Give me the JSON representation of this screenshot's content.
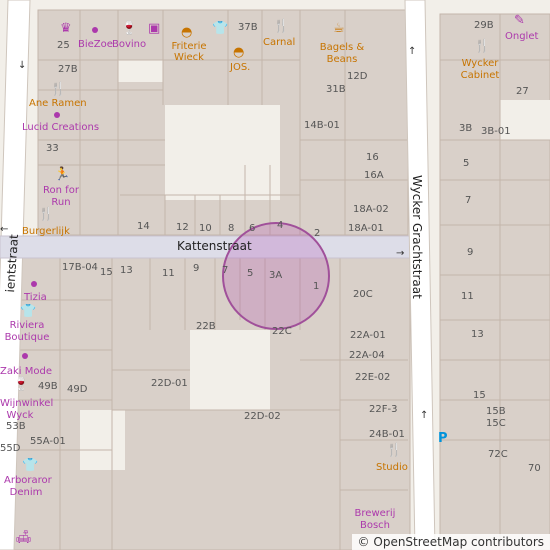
{
  "map": {
    "streets": [
      {
        "name": "Kattenstraat"
      },
      {
        "name": "Wycker Grachtstraat"
      },
      {
        "name": "ientstraat"
      }
    ],
    "building_numbers": [
      "25",
      "27B",
      "33",
      "37B",
      "31B",
      "12D",
      "14B-01",
      "16",
      "16A",
      "18A-02",
      "18A-01",
      "14",
      "12",
      "10",
      "8",
      "6",
      "4",
      "2",
      "17B-04",
      "15",
      "13",
      "11",
      "9",
      "7",
      "5",
      "3A",
      "1",
      "20C",
      "22B",
      "22C",
      "22A-01",
      "22A-04",
      "49B",
      "49D",
      "22D-01",
      "22E-02",
      "22D-02",
      "22F-3",
      "53B",
      "55A-01",
      "55D",
      "24B-01",
      "29B",
      "27",
      "3B",
      "3B-01",
      "5",
      "7",
      "9",
      "11",
      "13",
      "15",
      "15B",
      "15C",
      "72C",
      "70"
    ],
    "pois": [
      {
        "name": "BieZoe",
        "category": "shop"
      },
      {
        "name": "Bovino",
        "category": "shop"
      },
      {
        "name": "Friterie Wieck",
        "category": "fast-food"
      },
      {
        "name": "JOS.",
        "category": "fast-food"
      },
      {
        "name": "Carnal",
        "category": "restaurant"
      },
      {
        "name": "Bagels & Beans",
        "category": "cafe"
      },
      {
        "name": "Onglet",
        "category": "shop"
      },
      {
        "name": "Wycker Cabinet",
        "category": "restaurant"
      },
      {
        "name": "Ane Ramen",
        "category": "restaurant"
      },
      {
        "name": "Lucid Creations",
        "category": "shop"
      },
      {
        "name": "Ron for Run",
        "category": "sports"
      },
      {
        "name": "Burgerlijk",
        "category": "restaurant"
      },
      {
        "name": "Tizia",
        "category": "shop"
      },
      {
        "name": "Riviera Boutique",
        "category": "clothes"
      },
      {
        "name": "Zaki Mode",
        "category": "shop"
      },
      {
        "name": "Wijnwinkel Wyck",
        "category": "wine"
      },
      {
        "name": "Arboraror Denim",
        "category": "clothes"
      },
      {
        "name": "Studio",
        "category": "restaurant"
      },
      {
        "name": "Brewerij Bosch",
        "category": "brewery"
      }
    ],
    "marker": {
      "type": "circle",
      "color": "#ac39ac"
    },
    "attribution": {
      "symbol": "©",
      "text": "OpenStreetMap contributors"
    },
    "colors": {
      "background": "#f2efe9",
      "building": "#d9d0c9",
      "road": "#ffffff",
      "pedestrian": "#dddde8",
      "poi": "#c77400",
      "shop": "#ac39ac"
    }
  }
}
